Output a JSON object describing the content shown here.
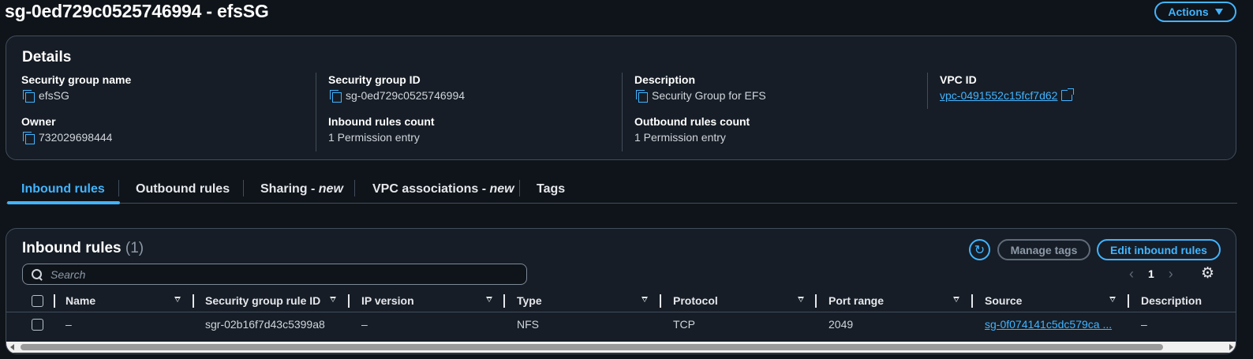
{
  "header": {
    "title": "sg-0ed729c0525746994 - efsSG",
    "actions_label": "Actions"
  },
  "details": {
    "heading": "Details",
    "sg_name_label": "Security group name",
    "sg_name": "efsSG",
    "sg_id_label": "Security group ID",
    "sg_id": "sg-0ed729c0525746994",
    "description_label": "Description",
    "description": "Security Group for EFS",
    "vpc_id_label": "VPC ID",
    "vpc_id": "vpc-0491552c15fcf7d62",
    "owner_label": "Owner",
    "owner": "732029698444",
    "inbound_count_label": "Inbound rules count",
    "inbound_count": "1 Permission entry",
    "outbound_count_label": "Outbound rules count",
    "outbound_count": "1 Permission entry"
  },
  "tabs": [
    {
      "label": "Inbound rules",
      "suffix": "",
      "active": true
    },
    {
      "label": "Outbound rules",
      "suffix": "",
      "active": false
    },
    {
      "label": "Sharing - ",
      "suffix": "new",
      "active": false
    },
    {
      "label": "VPC associations - ",
      "suffix": "new",
      "active": false
    },
    {
      "label": "Tags",
      "suffix": "",
      "active": false
    }
  ],
  "inbound_rules": {
    "heading": "Inbound rules",
    "count": "(1)",
    "manage_tags_label": "Manage tags",
    "edit_label": "Edit inbound rules",
    "search_placeholder": "Search",
    "page": "1",
    "columns": [
      "Name",
      "Security group rule ID",
      "IP version",
      "Type",
      "Protocol",
      "Port range",
      "Source",
      "Description"
    ],
    "rows": [
      {
        "name": "–",
        "rule_id": "sgr-02b16f7d43c5399a8",
        "ip_version": "–",
        "type": "NFS",
        "protocol": "TCP",
        "port_range": "2049",
        "source": "sg-0f074141c5dc579ca ...",
        "description": "–"
      }
    ]
  },
  "colors": {
    "background": "#0f141a",
    "panel": "#161d26",
    "accent": "#42b4ff",
    "border": "#414d5c"
  },
  "icons": [
    "copy-icon",
    "external-link-icon",
    "refresh-icon",
    "search-icon",
    "chevron-left-icon",
    "chevron-right-icon",
    "settings-gear-icon",
    "sort-down-icon",
    "caret-down-icon"
  ]
}
